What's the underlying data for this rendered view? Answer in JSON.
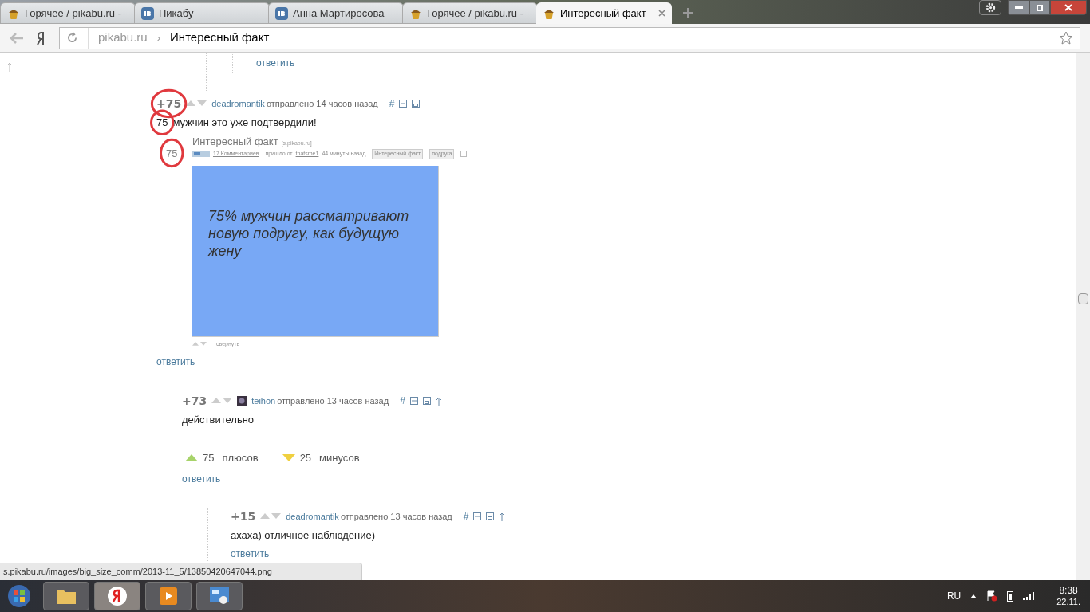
{
  "tabs": [
    {
      "title": "Горячее / pikabu.ru -",
      "kind": "pikabu",
      "selected": false
    },
    {
      "title": "Пикабу",
      "kind": "vk",
      "selected": false
    },
    {
      "title": "Анна Мартиросова",
      "kind": "vk",
      "selected": false
    },
    {
      "title": "Горячее / pikabu.ru -",
      "kind": "pikabu",
      "selected": false
    },
    {
      "title": "Интересный факт",
      "kind": "pikabu",
      "selected": true
    }
  ],
  "address": {
    "host": "pikabu.ru",
    "separator": "›",
    "page": "Интересный факт"
  },
  "top_reply": "ответить",
  "comments": [
    {
      "score": "+75",
      "score_circled": true,
      "author": "deadromantik",
      "avatar": false,
      "meta": "отправлено 14 часов назад",
      "anchor": "#",
      "parent_link": false,
      "body_circled": "75",
      "body": "мужчин это уже подтвердили!",
      "post": {
        "rating": "75",
        "rating_circled": true,
        "title": "Интересный факт",
        "source": "[s.pikabu.ru]",
        "comments_link": "17 Комментариев",
        "from": "; пришло от",
        "user": "thatsme1",
        "time": "44 минуты назад",
        "tags": [
          "Интересный факт",
          "подруга"
        ],
        "image_text": "75% мужчин рассматривают новую подругу, как будущую жену",
        "collapse": "свернуть"
      },
      "reply": "ответить",
      "children": [
        {
          "score": "+73",
          "score_circled": false,
          "author": "teihon",
          "avatar": true,
          "meta": "отправлено 13 часов назад",
          "anchor": "#",
          "parent_link": true,
          "body": "действительно",
          "votes": {
            "plus_count": "75",
            "plus_label": "плюсов",
            "minus_count": "25",
            "minus_label": "минусов"
          },
          "reply": "ответить",
          "children": [
            {
              "score": "+15",
              "score_circled": false,
              "author": "deadromantik",
              "avatar": false,
              "meta": "отправлено 13 часов назад",
              "anchor": "#",
              "parent_link": true,
              "body": "ахаха) отличное наблюдение)",
              "reply": "ответить"
            }
          ]
        }
      ]
    }
  ],
  "status_url": "s.pikabu.ru/images/big_size_comm/2013-11_5/13850420647044.png",
  "taskbar": {
    "language": "RU",
    "time": "8:38",
    "date": "22.11."
  }
}
